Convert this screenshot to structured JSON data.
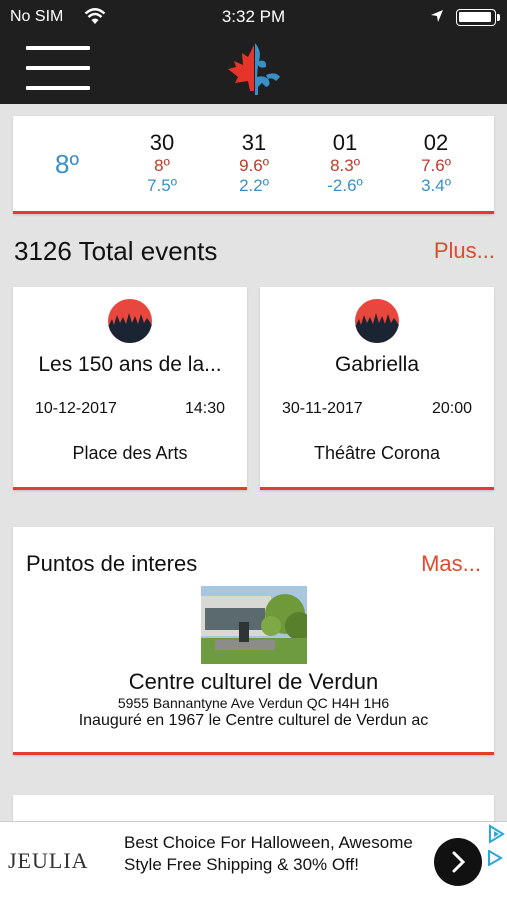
{
  "status_bar": {
    "carrier": "No SIM",
    "time": "3:32 PM"
  },
  "weather": {
    "current": "8º",
    "days": [
      {
        "day": "30",
        "high": "8º",
        "low": "7.5º"
      },
      {
        "day": "31",
        "high": "9.6º",
        "low": "2.2º"
      },
      {
        "day": "01",
        "high": "8.3º",
        "low": "-2.6º"
      },
      {
        "day": "02",
        "high": "7.6º",
        "low": "3.4º"
      }
    ]
  },
  "events": {
    "title": "3126 Total events",
    "more_label": "Plus...",
    "items": [
      {
        "title": "Les 150 ans de la...",
        "date": "10-12-2017",
        "time": "14:30",
        "venue": "Place des Arts"
      },
      {
        "title": "Gabriella",
        "date": "30-11-2017",
        "time": "20:00",
        "venue": "Théâtre Corona"
      }
    ]
  },
  "poi": {
    "title": "Puntos de interes",
    "more_label": "Mas...",
    "name": "Centre culturel de Verdun",
    "address": "5955 Bannantyne Ave Verdun QC H4H 1H6",
    "description": "Inauguré en 1967 le Centre culturel de Verdun ac"
  },
  "ad": {
    "brand": "JEULIA",
    "text": "Best Choice For Halloween, Awesome Style Free Shipping & 30% Off!"
  },
  "colors": {
    "accent": "#e53b2f",
    "header": "#1f1f1f",
    "cold": "#3a8fc6",
    "hot": "#c0392b"
  }
}
